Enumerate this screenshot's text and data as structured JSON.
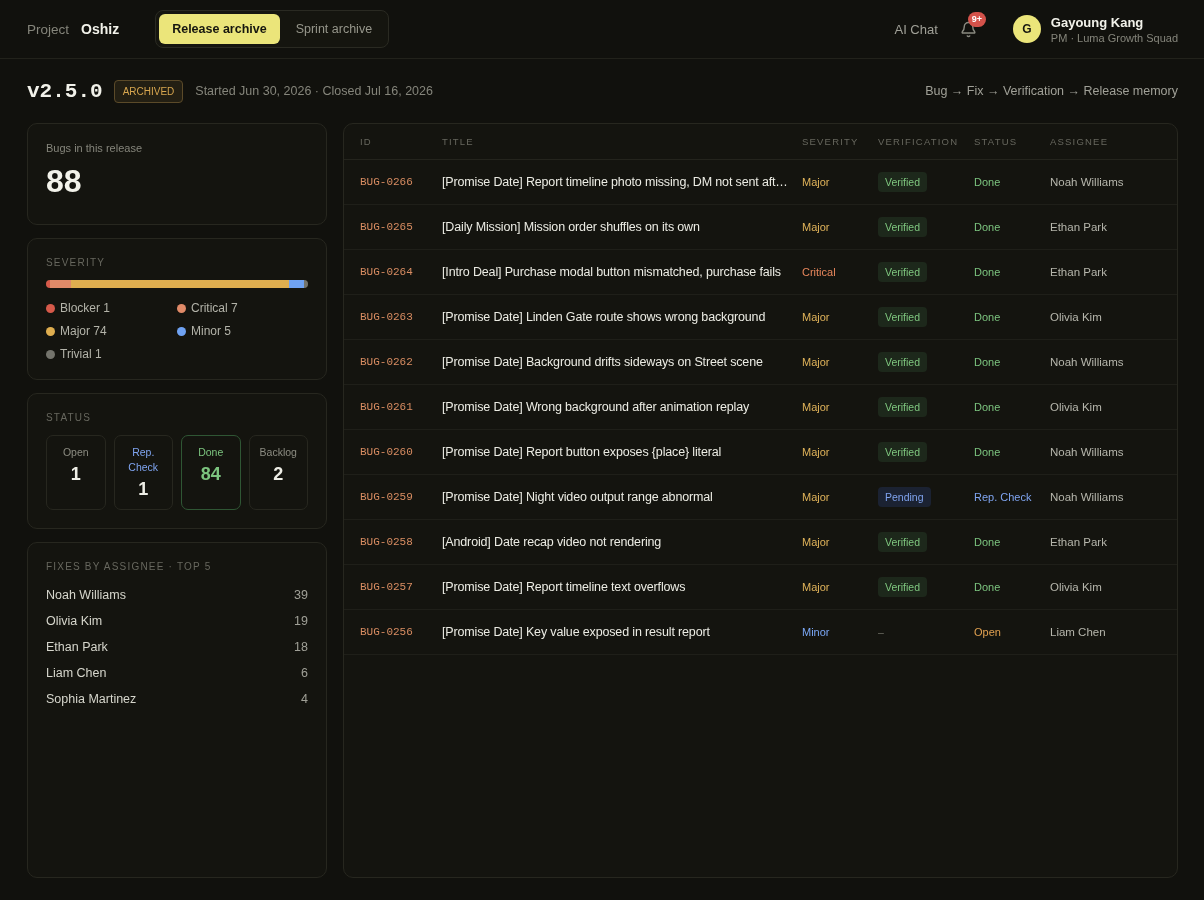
{
  "topbar": {
    "breadcrumb": {
      "label": "Project",
      "project": "Oshiz"
    },
    "tabs": [
      {
        "label": "Release archive",
        "selected": true
      },
      {
        "label": "Sprint archive",
        "selected": false
      }
    ],
    "ai_chat": "AI Chat",
    "notifications": {
      "badge": "9+"
    },
    "user": {
      "initial": "G",
      "name": "Gayoung Kang",
      "role": "PM · Luma Growth Squad"
    }
  },
  "release": {
    "version": "v2.5.0",
    "badge": "ARCHIVED",
    "dates": "Started Jun 30, 2026 · Closed Jul 16, 2026",
    "flow": "Bug → Fix → Verification → Release memory"
  },
  "summary": {
    "label": "Bugs in this release",
    "count": "88"
  },
  "severity": {
    "title": "SEVERITY",
    "items": [
      {
        "name": "Blocker",
        "count": "1",
        "color": "#d65a4a"
      },
      {
        "name": "Critical",
        "count": "7",
        "color": "#e08a68"
      },
      {
        "name": "Major",
        "count": "74",
        "color": "#dfae4f"
      },
      {
        "name": "Minor",
        "count": "5",
        "color": "#6fa2f2"
      },
      {
        "name": "Trivial",
        "count": "1",
        "color": "#74746c"
      }
    ]
  },
  "status": {
    "title": "STATUS",
    "tiles": [
      {
        "label": "Open",
        "count": "1",
        "kind": "open"
      },
      {
        "label": "Rep. Check",
        "count": "1",
        "kind": "recheck"
      },
      {
        "label": "Done",
        "count": "84",
        "kind": "done"
      },
      {
        "label": "Backlog",
        "count": "2",
        "kind": "backlog"
      }
    ]
  },
  "fixes": {
    "title": "FIXES BY ASSIGNEE · TOP 5",
    "rows": [
      {
        "name": "Noah Williams",
        "count": "39"
      },
      {
        "name": "Olivia Kim",
        "count": "19"
      },
      {
        "name": "Ethan Park",
        "count": "18"
      },
      {
        "name": "Liam Chen",
        "count": "6"
      },
      {
        "name": "Sophia Martinez",
        "count": "4"
      }
    ]
  },
  "table": {
    "columns": [
      "ID",
      "TITLE",
      "SEVERITY",
      "VERIFICATION",
      "STATUS",
      "ASSIGNEE"
    ],
    "rows": [
      {
        "id": "BUG-0266",
        "title": "[Promise Date] Report timeline photo missing, DM not sent aft…",
        "severity": {
          "label": "Major",
          "kind": "major"
        },
        "verification": {
          "label": "Verified",
          "kind": "verified"
        },
        "status": {
          "label": "Done",
          "kind": "done"
        },
        "assignee": "Noah Williams"
      },
      {
        "id": "BUG-0265",
        "title": "[Daily Mission] Mission order shuffles on its own",
        "severity": {
          "label": "Major",
          "kind": "major"
        },
        "verification": {
          "label": "Verified",
          "kind": "verified"
        },
        "status": {
          "label": "Done",
          "kind": "done"
        },
        "assignee": "Ethan Park"
      },
      {
        "id": "BUG-0264",
        "title": "[Intro Deal] Purchase modal button mismatched, purchase fails",
        "severity": {
          "label": "Critical",
          "kind": "critical"
        },
        "verification": {
          "label": "Verified",
          "kind": "verified"
        },
        "status": {
          "label": "Done",
          "kind": "done"
        },
        "assignee": "Ethan Park"
      },
      {
        "id": "BUG-0263",
        "title": "[Promise Date] Linden Gate route shows wrong background",
        "severity": {
          "label": "Major",
          "kind": "major"
        },
        "verification": {
          "label": "Verified",
          "kind": "verified"
        },
        "status": {
          "label": "Done",
          "kind": "done"
        },
        "assignee": "Olivia Kim"
      },
      {
        "id": "BUG-0262",
        "title": "[Promise Date] Background drifts sideways on Street scene",
        "severity": {
          "label": "Major",
          "kind": "major"
        },
        "verification": {
          "label": "Verified",
          "kind": "verified"
        },
        "status": {
          "label": "Done",
          "kind": "done"
        },
        "assignee": "Noah Williams"
      },
      {
        "id": "BUG-0261",
        "title": "[Promise Date] Wrong background after animation replay",
        "severity": {
          "label": "Major",
          "kind": "major"
        },
        "verification": {
          "label": "Verified",
          "kind": "verified"
        },
        "status": {
          "label": "Done",
          "kind": "done"
        },
        "assignee": "Olivia Kim"
      },
      {
        "id": "BUG-0260",
        "title": "[Promise Date] Report button exposes {place} literal",
        "severity": {
          "label": "Major",
          "kind": "major"
        },
        "verification": {
          "label": "Verified",
          "kind": "verified"
        },
        "status": {
          "label": "Done",
          "kind": "done"
        },
        "assignee": "Noah Williams"
      },
      {
        "id": "BUG-0259",
        "title": "[Promise Date] Night video output range abnormal",
        "severity": {
          "label": "Major",
          "kind": "major"
        },
        "verification": {
          "label": "Pending",
          "kind": "pending"
        },
        "status": {
          "label": "Rep. Check",
          "kind": "recheck"
        },
        "assignee": "Noah Williams"
      },
      {
        "id": "BUG-0258",
        "title": "[Android] Date recap video not rendering",
        "severity": {
          "label": "Major",
          "kind": "major"
        },
        "verification": {
          "label": "Verified",
          "kind": "verified"
        },
        "status": {
          "label": "Done",
          "kind": "done"
        },
        "assignee": "Ethan Park"
      },
      {
        "id": "BUG-0257",
        "title": "[Promise Date] Report timeline text overflows",
        "severity": {
          "label": "Major",
          "kind": "major"
        },
        "verification": {
          "label": "Verified",
          "kind": "verified"
        },
        "status": {
          "label": "Done",
          "kind": "done"
        },
        "assignee": "Olivia Kim"
      },
      {
        "id": "BUG-0256",
        "title": "[Promise Date] Key value exposed in result report",
        "severity": {
          "label": "Minor",
          "kind": "minor"
        },
        "verification": {
          "label": "–",
          "kind": "none"
        },
        "status": {
          "label": "Open",
          "kind": "open"
        },
        "assignee": "Liam Chen"
      }
    ]
  }
}
